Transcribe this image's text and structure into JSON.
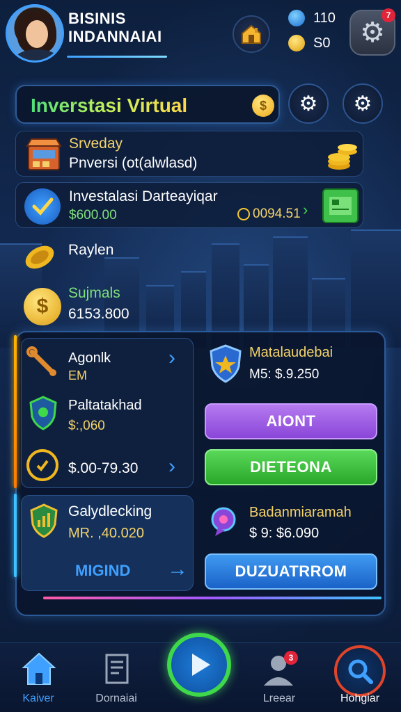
{
  "header": {
    "player_name_line1": "BISINIS",
    "player_name_line2": "INDANNAIAI",
    "gems": "110",
    "coins": "S0",
    "notification_count": "7"
  },
  "title": {
    "text": "Inverstasi Virtual"
  },
  "rows": {
    "survey": {
      "title": "Srveday",
      "subtitle": "Pnversi (ot(alwlasd)"
    },
    "investment": {
      "title": "Investalasi Darteayiqar",
      "value": "$600.00",
      "badge_value": "0094.51"
    },
    "reward": {
      "title": "Raylen"
    },
    "summary": {
      "title": "Sujmals",
      "value": "6153.800"
    }
  },
  "panel": {
    "agent": {
      "title": "Agonlk",
      "subtitle": "EM"
    },
    "protection": {
      "title": "Paltatakhad",
      "value": "$:,060"
    },
    "range": {
      "value": "$.00-79.30"
    },
    "shield_card": {
      "title": "Matalaudebai",
      "value": "M5: $.9.250"
    },
    "aiont_button": "AIONT",
    "dieteona_button": "DIETEONA",
    "analytics": {
      "title": "Galydlecking",
      "value": "MR. ,40.020",
      "link": "MIGIND"
    },
    "balance": {
      "title": "Badanmiaramah",
      "value": "$ 9: $6.090"
    },
    "duzuatrrom_button": "DUZUATRROM"
  },
  "nav": {
    "home": "Kaiver",
    "docs": "Dornaiai",
    "play": "",
    "profile": "Lreear",
    "profile_badge": "3",
    "search": "Hohgiar"
  },
  "colors": {
    "accent_blue": "#3fa0ff",
    "accent_green": "#3fd84a",
    "accent_purple": "#9a56e0",
    "gold": "#f0c030",
    "alert_red": "#e0243a"
  }
}
